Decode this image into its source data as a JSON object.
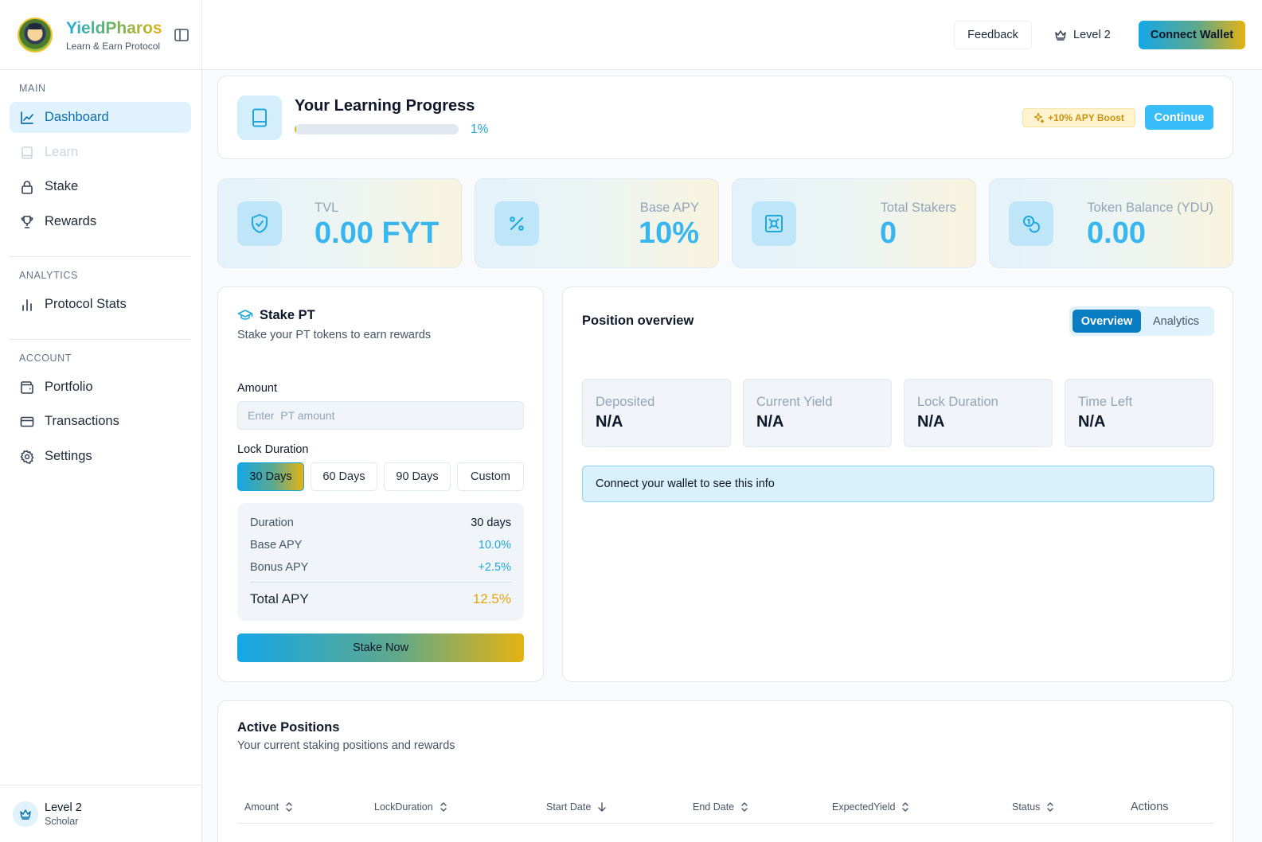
{
  "brand": {
    "name": "YieldPharos",
    "subtitle": "Learn & Earn Protocol"
  },
  "sidebar": {
    "sections": [
      {
        "label": "MAIN",
        "items": [
          {
            "label": "Dashboard",
            "icon": "chart-line-icon",
            "state": "active"
          },
          {
            "label": "Learn",
            "icon": "book-icon",
            "state": "disabled"
          },
          {
            "label": "Stake",
            "icon": "lock-icon",
            "state": "normal"
          },
          {
            "label": "Rewards",
            "icon": "trophy-icon",
            "state": "normal"
          }
        ]
      },
      {
        "label": "ANALYTICS",
        "items": [
          {
            "label": "Protocol Stats",
            "icon": "bar-chart-icon",
            "state": "normal"
          }
        ]
      },
      {
        "label": "ACCOUNT",
        "items": [
          {
            "label": "Portfolio",
            "icon": "wallet-icon",
            "state": "normal"
          },
          {
            "label": "Transactions",
            "icon": "credit-card-icon",
            "state": "normal"
          },
          {
            "label": "Settings",
            "icon": "gear-icon",
            "state": "normal"
          }
        ]
      }
    ],
    "footer": {
      "level": "Level 2",
      "rank": "Scholar",
      "icon": "crown-icon"
    }
  },
  "header": {
    "feedback_label": "Feedback",
    "level_label": "Level 2",
    "connect_label": "Connect Wallet"
  },
  "progress": {
    "title": "Your Learning Progress",
    "percent_label": "1%",
    "percent_value": 1,
    "boost_label": "+10% APY Boost",
    "continue_label": "Continue"
  },
  "stats": [
    {
      "label": "TVL",
      "value": "0.00 FYT",
      "icon": "shield-check-icon"
    },
    {
      "label": "Base APY",
      "value": "10%",
      "icon": "percent-icon"
    },
    {
      "label": "Total Stakers",
      "value": "0",
      "icon": "vault-icon"
    },
    {
      "label": "Token Balance (YDU)",
      "value": "0.00",
      "icon": "coins-icon"
    }
  ],
  "stake": {
    "title": "Stake PT",
    "subtitle": "Stake your PT tokens to earn rewards",
    "amount_label": "Amount",
    "amount_placeholder": "Enter  PT amount",
    "lock_label": "Lock Duration",
    "durations": [
      "30 Days",
      "60 Days",
      "90 Days",
      "Custom"
    ],
    "selected_duration": "30 Days",
    "summary": {
      "duration_k": "Duration",
      "duration_v": "30 days",
      "base_k": "Base APY",
      "base_v": "10.0%",
      "bonus_k": "Bonus APY",
      "bonus_v": "+2.5%",
      "total_k": "Total APY",
      "total_v": "12.5%"
    },
    "stake_button": "Stake Now"
  },
  "position": {
    "title": "Position overview",
    "tabs": [
      "Overview",
      "Analytics"
    ],
    "active_tab": "Overview",
    "metrics": [
      {
        "label": "Deposited",
        "value": "N/A"
      },
      {
        "label": "Current Yield",
        "value": "N/A"
      },
      {
        "label": "Lock Duration",
        "value": "N/A"
      },
      {
        "label": "Time Left",
        "value": "N/A"
      }
    ],
    "notice": "Connect your wallet to see this info"
  },
  "active_positions": {
    "title": "Active Positions",
    "subtitle": "Your current staking positions and rewards",
    "columns": [
      "Amount",
      "LockDuration",
      "Start Date",
      "End Date",
      "ExpectedYield",
      "Status",
      "Actions"
    ]
  },
  "colors": {
    "accent": "#38b6ef",
    "brand_gold": "#e5b212",
    "active_tab": "#0a7cc1"
  }
}
